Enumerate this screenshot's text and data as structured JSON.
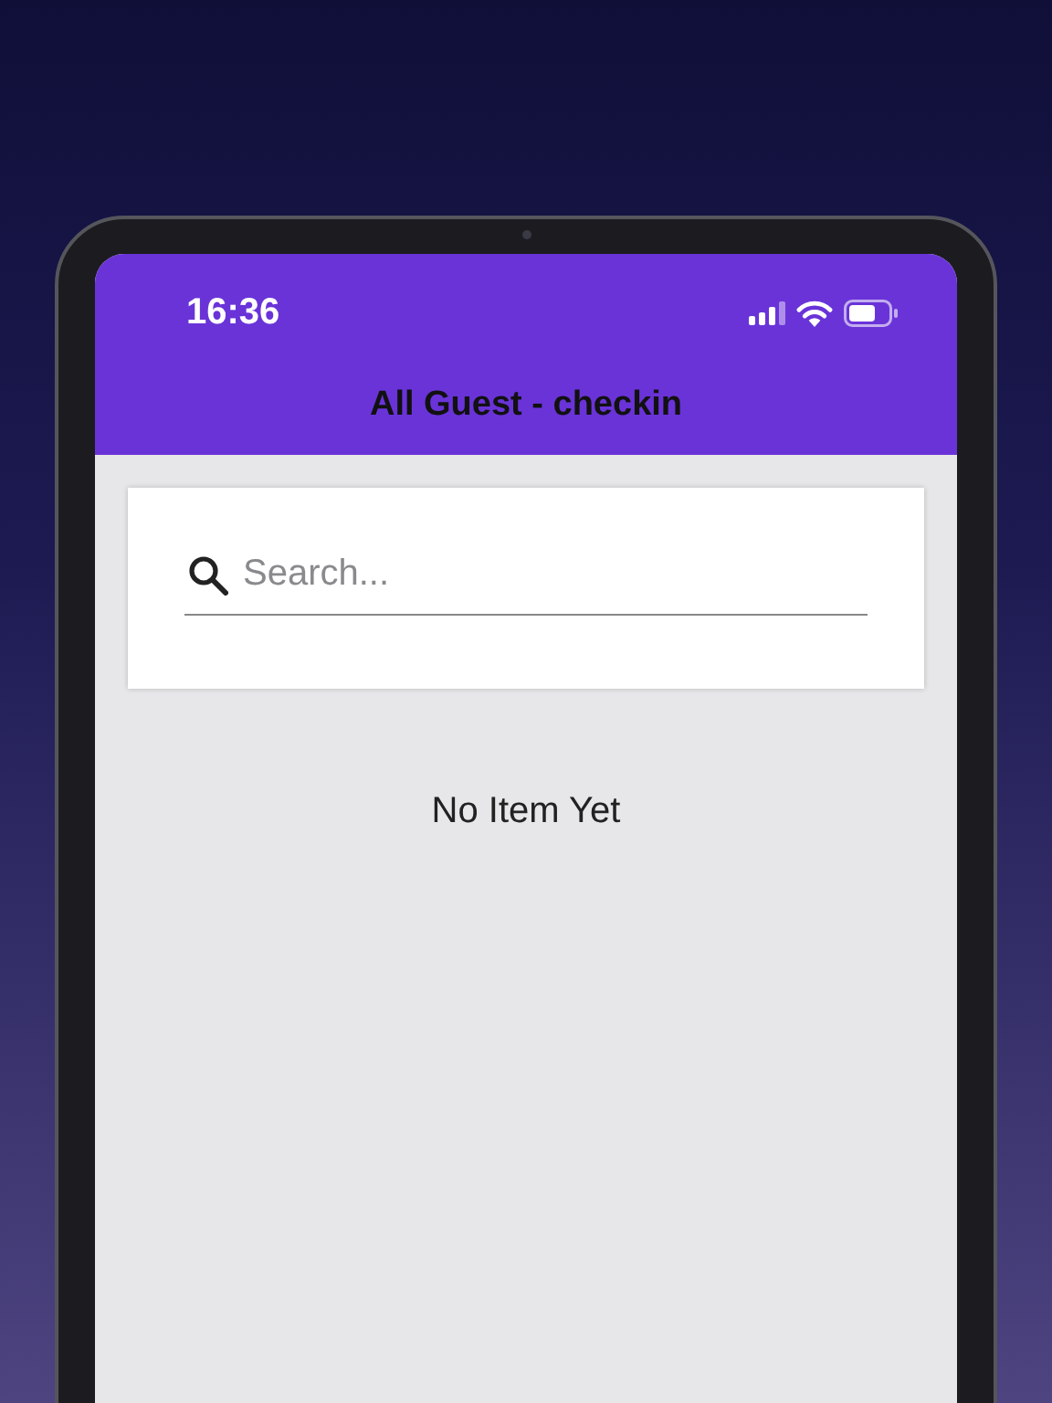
{
  "status_bar": {
    "time": "16:36"
  },
  "header": {
    "title": "All Guest - checkin"
  },
  "search": {
    "placeholder": "Search..."
  },
  "empty_message": "No Item Yet"
}
